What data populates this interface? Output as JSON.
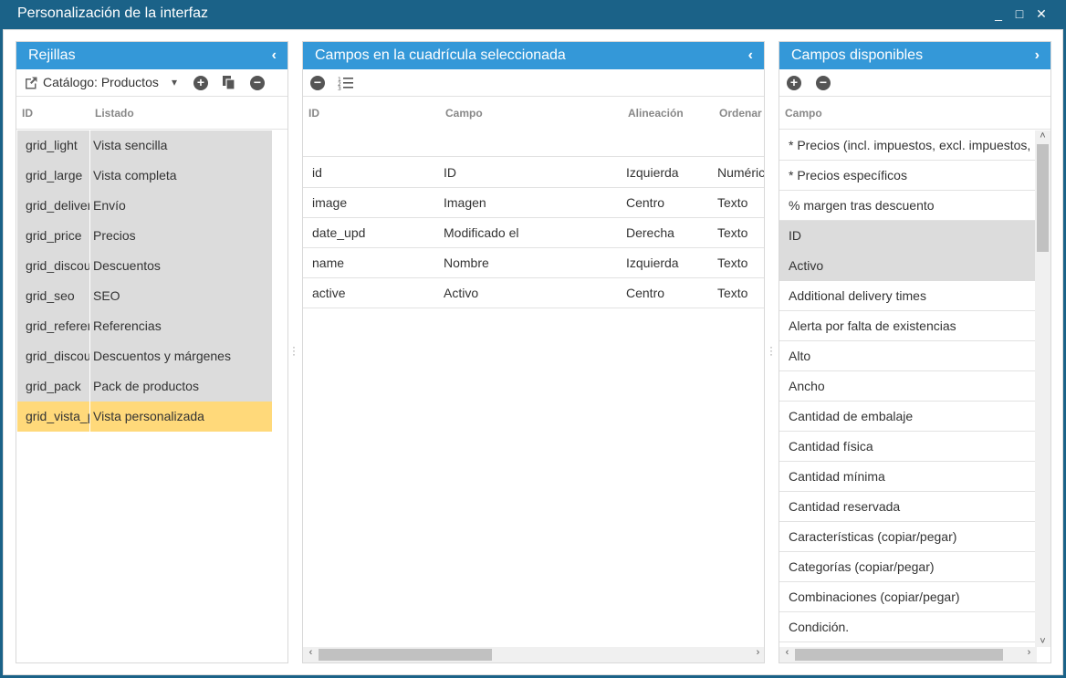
{
  "window": {
    "title": "Personalización de la interfaz",
    "min_icon": "_",
    "max_icon": "□",
    "close_icon": "✕"
  },
  "left_panel": {
    "title": "Rejillas",
    "collapse_icon": "‹",
    "catalog_label": "Catálogo: Productos",
    "dropdown_icon": "▾",
    "columns": {
      "id": "ID",
      "list": "Listado"
    },
    "rows": [
      {
        "id": "grid_light",
        "list": "Vista sencilla"
      },
      {
        "id": "grid_large",
        "list": "Vista completa"
      },
      {
        "id": "grid_delivery",
        "list": "Envío"
      },
      {
        "id": "grid_price",
        "list": "Precios"
      },
      {
        "id": "grid_discounts",
        "list": "Descuentos"
      },
      {
        "id": "grid_seo",
        "list": "SEO"
      },
      {
        "id": "grid_reference",
        "list": "Referencias"
      },
      {
        "id": "grid_discounts_margins",
        "list": "Descuentos y márgenes"
      },
      {
        "id": "grid_pack",
        "list": "Pack de productos"
      },
      {
        "id": "grid_vista_personalizada",
        "list": "Vista personalizada"
      }
    ],
    "selected_index": 9
  },
  "mid_panel": {
    "title": "Campos en la cuadrícula seleccionada",
    "collapse_icon": "‹",
    "columns": {
      "id": "ID",
      "field": "Campo",
      "align": "Alineación",
      "sort": "Ordenar"
    },
    "rows": [
      {
        "id": "id",
        "field": "ID",
        "align": "Izquierda",
        "sort": "Numérico"
      },
      {
        "id": "image",
        "field": "Imagen",
        "align": "Centro",
        "sort": "Texto"
      },
      {
        "id": "date_upd",
        "field": "Modificado el",
        "align": "Derecha",
        "sort": "Texto"
      },
      {
        "id": "name",
        "field": "Nombre",
        "align": "Izquierda",
        "sort": "Texto"
      },
      {
        "id": "active",
        "field": "Activo",
        "align": "Centro",
        "sort": "Texto"
      }
    ]
  },
  "right_panel": {
    "title": "Campos disponibles",
    "expand_icon": "›",
    "columns": {
      "field": "Campo"
    },
    "rows": [
      {
        "field": "* Precios (incl. impuestos, excl. impuestos, i",
        "highlight": false
      },
      {
        "field": "* Precios específicos",
        "highlight": false
      },
      {
        "field": "% margen tras descuento",
        "highlight": false
      },
      {
        "field": "ID",
        "highlight": true
      },
      {
        "field": "Activo",
        "highlight": true
      },
      {
        "field": "Additional delivery times",
        "highlight": false
      },
      {
        "field": "Alerta por falta de existencias",
        "highlight": false
      },
      {
        "field": "Alto",
        "highlight": false
      },
      {
        "field": "Ancho",
        "highlight": false
      },
      {
        "field": "Cantidad de embalaje",
        "highlight": false
      },
      {
        "field": "Cantidad física",
        "highlight": false
      },
      {
        "field": "Cantidad mínima",
        "highlight": false
      },
      {
        "field": "Cantidad reservada",
        "highlight": false
      },
      {
        "field": "Características (copiar/pegar)",
        "highlight": false
      },
      {
        "field": "Categorías (copiar/pegar)",
        "highlight": false
      },
      {
        "field": "Combinaciones (copiar/pegar)",
        "highlight": false
      },
      {
        "field": "Condición.",
        "highlight": false
      }
    ]
  },
  "icons": {
    "external_link": "external-link-icon",
    "add": "plus-circle-icon",
    "copy": "copy-icon",
    "remove": "minus-circle-icon",
    "ordered_list": "ordered-list-icon"
  },
  "colors": {
    "title_bar": "#1b6288",
    "panel_header": "#3498d8",
    "selected_row": "#ffd97a",
    "grey_row": "#dcdcdc"
  }
}
